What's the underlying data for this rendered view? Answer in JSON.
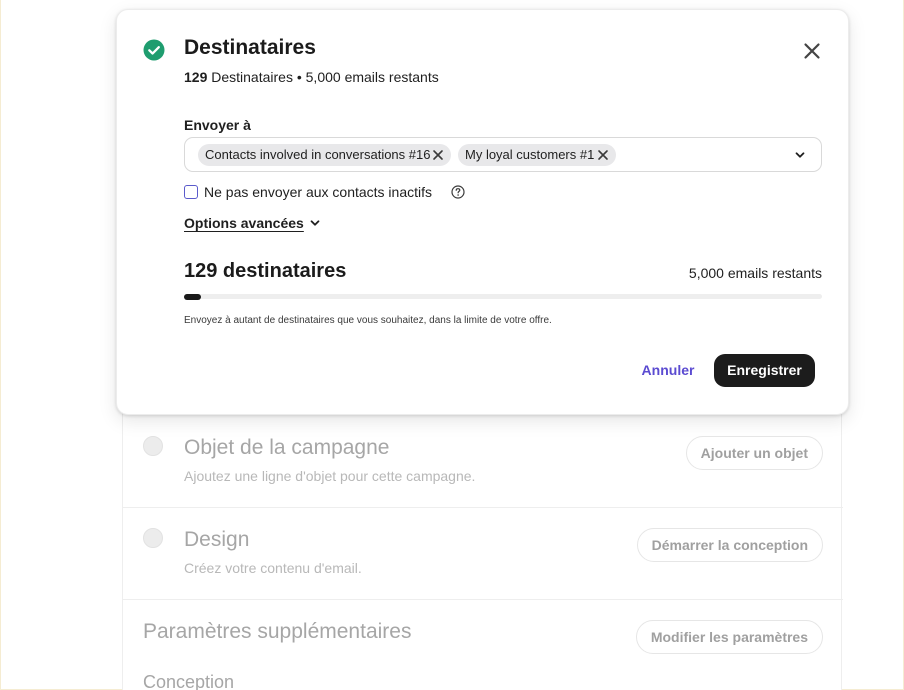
{
  "modal": {
    "title": "Destinataires",
    "subtitle_count": "129",
    "subtitle_rest": " Destinataires",
    "subtitle_sep": " • ",
    "subtitle_remaining": "5,000 emails restants",
    "send_to_label": "Envoyer à",
    "tags": [
      {
        "label": "Contacts involved in conversations #16"
      },
      {
        "label": "My loyal customers #1"
      }
    ],
    "inactive_checkbox_label": "Ne pas envoyer aux contacts inactifs",
    "inactive_checked": false,
    "advanced_options_label": "Options avancées",
    "recipients_count_label": "129 destinataires",
    "remaining_label": "5,000 emails restants",
    "progress_fraction": 0.026,
    "hint": "Envoyez à autant de destinataires que vous souhaitez, dans la limite de votre offre.",
    "cancel_label": "Annuler",
    "save_label": "Enregistrer"
  },
  "sections": {
    "subject": {
      "title": "Objet de la campagne",
      "description": "Ajoutez une ligne d'objet pour cette campagne.",
      "button": "Ajouter un objet"
    },
    "design": {
      "title": "Design",
      "description": "Créez votre contenu d'email.",
      "button": "Démarrer la conception"
    },
    "settings": {
      "title": "Paramètres supplémentaires",
      "button": "Modifier les paramètres",
      "next_title": "Conception"
    }
  },
  "colors": {
    "success": "#1f9d6f",
    "accent": "#5b4bd1",
    "primary_button": "#1c1c1c"
  },
  "icons": {
    "check": "check-circle-icon",
    "close": "close-icon",
    "tag_remove": "x-icon",
    "dropdown": "chevron-down-icon",
    "help": "question-circle-icon"
  }
}
